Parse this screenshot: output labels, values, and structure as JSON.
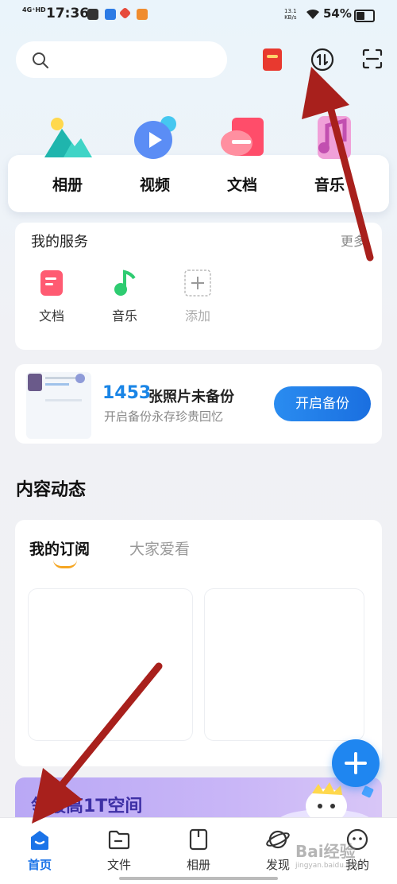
{
  "status_bar": {
    "network": "4G⁺HD",
    "time": "17:36",
    "speed_value": "13.1",
    "speed_unit": "KB/s",
    "battery": "54%"
  },
  "search": {
    "placeholder": ""
  },
  "categories": [
    {
      "label": "相册",
      "icon": "photo-album-icon"
    },
    {
      "label": "视频",
      "icon": "video-icon"
    },
    {
      "label": "文档",
      "icon": "document-icon"
    },
    {
      "label": "音乐",
      "icon": "music-icon"
    }
  ],
  "services": {
    "title": "我的服务",
    "more": "更多",
    "items": [
      {
        "label": "文档",
        "icon": "document-icon"
      },
      {
        "label": "音乐",
        "icon": "music-icon"
      },
      {
        "label": "添加",
        "icon": "add-icon"
      }
    ]
  },
  "backup": {
    "count": "1453",
    "unbacked_text": "张照片未备份",
    "subtitle": "开启备份永存珍贵回忆",
    "button": "开启备份"
  },
  "content": {
    "title": "内容动态",
    "tabs": [
      "我的订阅",
      "大家爱看"
    ]
  },
  "promo": {
    "text": "领最高1T空间"
  },
  "nav": [
    {
      "label": "首页",
      "icon": "home-icon",
      "active": true
    },
    {
      "label": "文件",
      "icon": "folder-icon"
    },
    {
      "label": "相册",
      "icon": "album-icon"
    },
    {
      "label": "发现",
      "icon": "planet-icon"
    },
    {
      "label": "我的",
      "icon": "profile-icon"
    }
  ],
  "watermark": {
    "text": "Bai经验",
    "sub": "jingyan.baidu.com"
  },
  "colors": {
    "accent": "#1a85e6",
    "arrow": "#a8201c"
  }
}
